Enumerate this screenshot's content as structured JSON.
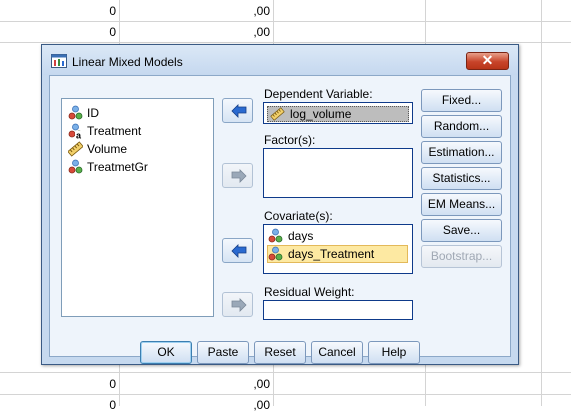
{
  "spreadsheet": {
    "rows": [
      {
        "c1": "0",
        "c2": ",00"
      },
      {
        "c1": "0",
        "c2": ",00"
      },
      {
        "c1": "0",
        "c2": ",00"
      },
      {
        "c1": "0",
        "c2": ",00"
      }
    ]
  },
  "dialog": {
    "title": "Linear Mixed Models",
    "close_glyph": "✕",
    "variables": [
      {
        "label": "ID",
        "icon": "nominal-icon"
      },
      {
        "label": "Treatment",
        "icon": "nominal-string-icon"
      },
      {
        "label": "Volume",
        "icon": "scale-icon"
      },
      {
        "label": "TreatmetGr",
        "icon": "nominal-icon"
      }
    ],
    "dependent_label": "Dependent Variable:",
    "dependent_value": "log_volume",
    "factors_label": "Factor(s):",
    "covariates_label": "Covariate(s):",
    "covariates": [
      {
        "label": "days",
        "icon": "nominal-icon"
      },
      {
        "label": "days_Treatment",
        "icon": "nominal-icon",
        "selected": true
      }
    ],
    "residual_label": "Residual Weight:",
    "right_buttons": {
      "fixed": "Fixed...",
      "random": "Random...",
      "estimation": "Estimation...",
      "statistics": "Statistics...",
      "em_means": "EM Means...",
      "save": "Save...",
      "bootstrap": "Bootstrap..."
    },
    "bottom_buttons": {
      "ok": "OK",
      "paste": "Paste",
      "reset": "Reset",
      "cancel": "Cancel",
      "help": "Help"
    }
  },
  "colors": {
    "dialog_bg": "#c6d9ef",
    "arrow_blue": "#2a6ad0",
    "selection_yellow": "#fde9a2"
  }
}
